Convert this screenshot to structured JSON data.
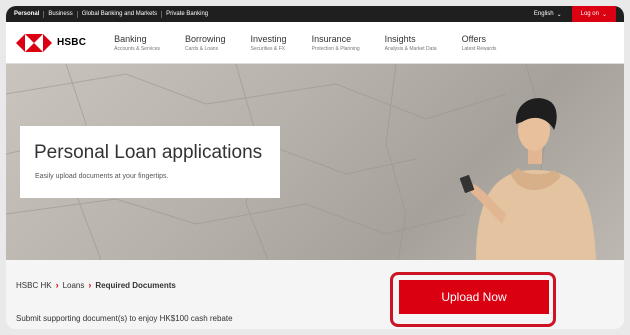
{
  "topbar": {
    "links": [
      "Personal",
      "Business",
      "Global Banking and Markets",
      "Private Banking"
    ],
    "language": "English",
    "logon": "Log on"
  },
  "brand": {
    "name": "HSBC"
  },
  "nav": [
    {
      "title": "Banking",
      "subtitle": "Accounts & Services"
    },
    {
      "title": "Borrowing",
      "subtitle": "Cards & Loans"
    },
    {
      "title": "Investing",
      "subtitle": "Securities & FX"
    },
    {
      "title": "Insurance",
      "subtitle": "Protection & Planning"
    },
    {
      "title": "Insights",
      "subtitle": "Analysis & Market Data"
    },
    {
      "title": "Offers",
      "subtitle": "Latest Rewards"
    }
  ],
  "hero": {
    "title": "Personal Loan applications",
    "subtitle": "Easily upload documents at your fingertips."
  },
  "breadcrumb": [
    "HSBC HK",
    "Loans",
    "Required Documents"
  ],
  "cta": {
    "label": "Upload Now"
  },
  "notice": "Submit supporting document(s) to enjoy HK$100 cash rebate",
  "colors": {
    "brand_red": "#db0011",
    "highlight": "#cc1424",
    "topbar": "#1f1f1f"
  },
  "icons": [
    "hsbc-logo-icon",
    "chevron-down-icon"
  ]
}
